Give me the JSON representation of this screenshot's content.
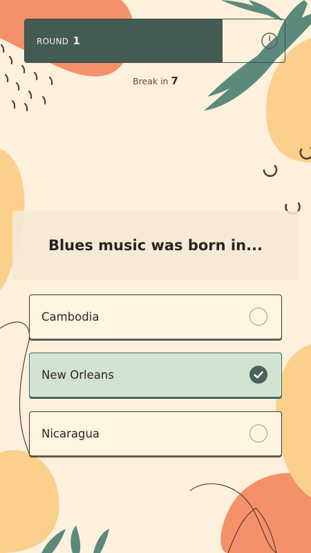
{
  "header": {
    "round_label": "ROUND",
    "round_number": "1",
    "round_progress": 0.76,
    "break_label": "Break in",
    "break_count": "7"
  },
  "question": {
    "text": "Blues music was born in..."
  },
  "options": [
    {
      "label": "Cambodia",
      "selected": false
    },
    {
      "label": "New Orleans",
      "selected": true
    },
    {
      "label": "Nicaragua",
      "selected": false
    }
  ],
  "colors": {
    "background": "#fdf0dc",
    "bar_fill": "#435b53",
    "leaf": "#5b8a7d",
    "coral": "#f4916a",
    "peach": "#fbd08d",
    "selected_bg": "#d2e3d3",
    "check": "#4a635b"
  },
  "icons": {
    "timer": "timer-icon",
    "check": "check-icon"
  }
}
